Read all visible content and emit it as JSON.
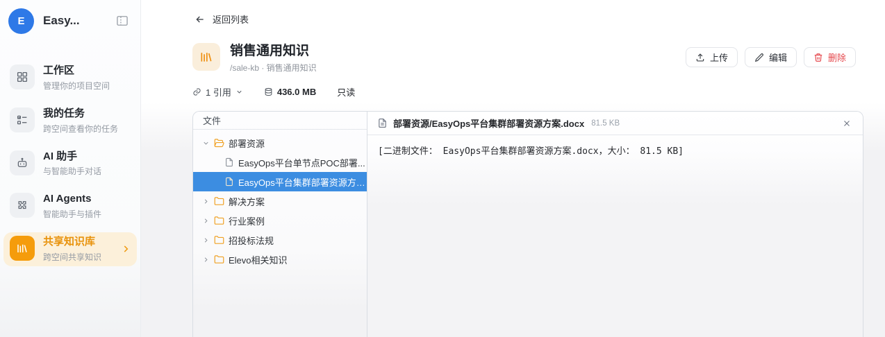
{
  "colors": {
    "accent_orange": "#f59c0b",
    "accent_orange_text": "#e8920b",
    "accent_orange_bg": "#fcf0da",
    "logo_blue": "#2e79e7",
    "selection_blue": "#3c8de1",
    "danger_red": "#e5484d",
    "folder_orange": "#f0a124"
  },
  "sidebar": {
    "logo_letter": "E",
    "app_name": "Easy...",
    "collapse_icon": "sidebar-collapse-icon",
    "items": [
      {
        "label": "工作区",
        "desc": "管理你的项目空间",
        "icon": "grid-icon",
        "active": false
      },
      {
        "label": "我的任务",
        "desc": "跨空间查看你的任务",
        "icon": "task-list-icon",
        "active": false
      },
      {
        "label": "AI 助手",
        "desc": "与智能助手对话",
        "icon": "robot-icon",
        "active": false
      },
      {
        "label": "AI Agents",
        "desc": "智能助手与插件",
        "icon": "puzzle-icon",
        "active": false
      },
      {
        "label": "共享知识库",
        "desc": "跨空间共享知识",
        "icon": "library-icon",
        "active": true
      }
    ]
  },
  "header": {
    "back_label": "返回列表",
    "title": "销售通用知识",
    "subtitle": "/sale-kb · 销售通用知识",
    "title_icon": "library-icon",
    "buttons": [
      {
        "label": "上传",
        "icon": "upload-icon"
      },
      {
        "label": "编辑",
        "icon": "pencil-icon"
      },
      {
        "label": "删除",
        "icon": "trash-icon",
        "danger": true
      }
    ]
  },
  "stats": {
    "references": "1 引用",
    "size": "436.0 MB",
    "readonly": "只读"
  },
  "file_tree": {
    "header": "文件",
    "nodes": [
      {
        "type": "folder",
        "state": "expanded",
        "label": "部署资源"
      },
      {
        "type": "file",
        "label": "EasyOps平台单节点POC部署...",
        "selected": false
      },
      {
        "type": "file",
        "label": "EasyOps平台集群部署资源方案...",
        "selected": true
      },
      {
        "type": "folder",
        "state": "collapsed",
        "label": "解决方案"
      },
      {
        "type": "folder",
        "state": "collapsed",
        "label": "行业案例"
      },
      {
        "type": "folder",
        "state": "collapsed",
        "label": "招投标法规"
      },
      {
        "type": "folder",
        "state": "collapsed",
        "label": "Elevo相关知识"
      }
    ]
  },
  "preview": {
    "filename": "部署资源/EasyOps平台集群部署资源方案.docx",
    "filesize": "81.5 KB",
    "content": "[二进制文件： EasyOps平台集群部署资源方案.docx，大小： 81.5 KB]"
  }
}
